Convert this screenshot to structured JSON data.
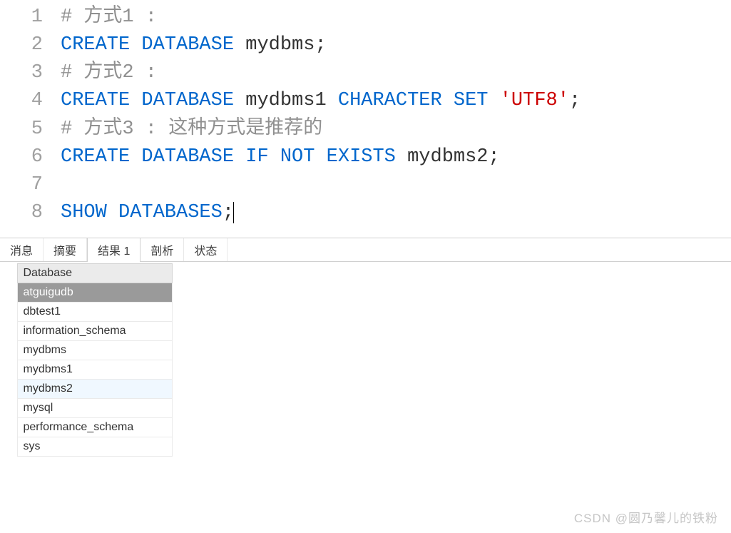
{
  "editor": {
    "lines": [
      {
        "num": "1",
        "tokens": [
          {
            "t": "# 方式1 :",
            "c": "comment"
          }
        ]
      },
      {
        "num": "2",
        "tokens": [
          {
            "t": "CREATE",
            "c": "keyword"
          },
          {
            "t": " ",
            "c": "ident"
          },
          {
            "t": "DATABASE",
            "c": "keyword"
          },
          {
            "t": " ",
            "c": "ident"
          },
          {
            "t": "mydbms",
            "c": "ident"
          },
          {
            "t": ";",
            "c": "punct"
          }
        ]
      },
      {
        "num": "3",
        "tokens": [
          {
            "t": "# 方式2 :",
            "c": "comment"
          }
        ]
      },
      {
        "num": "4",
        "tokens": [
          {
            "t": "CREATE",
            "c": "keyword"
          },
          {
            "t": " ",
            "c": "ident"
          },
          {
            "t": "DATABASE",
            "c": "keyword"
          },
          {
            "t": " ",
            "c": "ident"
          },
          {
            "t": "mydbms1",
            "c": "ident"
          },
          {
            "t": " ",
            "c": "ident"
          },
          {
            "t": "CHARACTER",
            "c": "keyword"
          },
          {
            "t": " ",
            "c": "ident"
          },
          {
            "t": "SET",
            "c": "keyword"
          },
          {
            "t": " ",
            "c": "ident"
          },
          {
            "t": "'UTF8'",
            "c": "string"
          },
          {
            "t": ";",
            "c": "punct"
          }
        ]
      },
      {
        "num": "5",
        "tokens": [
          {
            "t": "# 方式3 : 这种方式是推荐的",
            "c": "comment"
          }
        ]
      },
      {
        "num": "6",
        "tokens": [
          {
            "t": "CREATE",
            "c": "keyword"
          },
          {
            "t": " ",
            "c": "ident"
          },
          {
            "t": "DATABASE",
            "c": "keyword"
          },
          {
            "t": " ",
            "c": "ident"
          },
          {
            "t": "IF",
            "c": "keyword"
          },
          {
            "t": " ",
            "c": "ident"
          },
          {
            "t": "NOT",
            "c": "keyword"
          },
          {
            "t": " ",
            "c": "ident"
          },
          {
            "t": "EXISTS",
            "c": "keyword"
          },
          {
            "t": " ",
            "c": "ident"
          },
          {
            "t": "mydbms2",
            "c": "ident"
          },
          {
            "t": ";",
            "c": "punct"
          }
        ]
      },
      {
        "num": "7",
        "tokens": []
      },
      {
        "num": "8",
        "tokens": [
          {
            "t": "SHOW",
            "c": "keyword"
          },
          {
            "t": " ",
            "c": "ident"
          },
          {
            "t": "DATABASES",
            "c": "keyword"
          },
          {
            "t": ";",
            "c": "punct"
          }
        ],
        "cursor": true
      }
    ]
  },
  "tabs": {
    "items": [
      {
        "label": "消息",
        "active": false
      },
      {
        "label": "摘要",
        "active": false
      },
      {
        "label": "结果 1",
        "active": true
      },
      {
        "label": "剖析",
        "active": false
      },
      {
        "label": "状态",
        "active": false
      }
    ]
  },
  "results": {
    "header": "Database",
    "rows": [
      {
        "value": "atguigudb",
        "selected": true,
        "indicator": "▶"
      },
      {
        "value": "dbtest1"
      },
      {
        "value": "information_schema"
      },
      {
        "value": "mydbms"
      },
      {
        "value": "mydbms1"
      },
      {
        "value": "mydbms2",
        "highlight": true
      },
      {
        "value": "mysql"
      },
      {
        "value": "performance_schema"
      },
      {
        "value": "sys"
      }
    ]
  },
  "watermark": "CSDN @圆乃馨儿的铁粉"
}
